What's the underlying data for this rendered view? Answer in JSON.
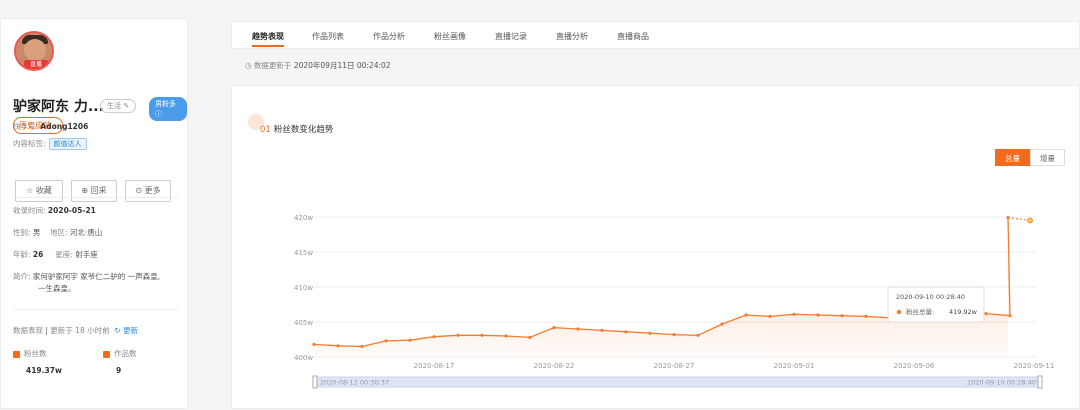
{
  "sidebar": {
    "avatar_tag": "直播",
    "name": "驴家阿东 力...",
    "gender_tag": "生活 ✎",
    "fans_tag": "男粉多 ⓘ",
    "history_label": "历史成就 ›",
    "kuaishou_label": "快手号:",
    "kuaishou_id": "Adong1206",
    "content_tag_label": "内容标签:",
    "content_tag": "颜值达人",
    "btn_collect": "☆ 收藏",
    "btn_back": "回采",
    "btn_more": "更多",
    "collect_time_label": "收录时间:",
    "collect_time": "2020-05-21",
    "gender_label": "性别:",
    "gender": "男",
    "region_label": "地区:",
    "region": "河北·唐山",
    "age_label": "年龄:",
    "age": "26",
    "zodiac_label": "星座:",
    "zodiac": "射手座",
    "intro_label": "简介:",
    "intro_line1": "家何驴家阿宇 家爷仁二驴的 一声森皇,",
    "intro_line2": "一生森皇。",
    "data_label": "数据表现",
    "data_update": "更新于 18 小时前",
    "refresh": "更新",
    "fans_label": "粉丝数",
    "fans_value": "419.37w",
    "works_label": "作品数",
    "works_value": "9"
  },
  "tabs": [
    "趋势表现",
    "作品列表",
    "作品分析",
    "粉丝画像",
    "直播记录",
    "直播分析",
    "直播商品"
  ],
  "update_text": "数据更新于",
  "update_time": "2020年09月11日 00:24:02",
  "section": {
    "num": "01",
    "title": "粉丝数变化趋势"
  },
  "toggles": {
    "total": "总量",
    "increment": "增量"
  },
  "tooltip": {
    "time": "2020-09-10 00:28:40",
    "label": "粉丝总量:",
    "value": "419.92w"
  },
  "range": {
    "start": "2020-08-12 00:30:37",
    "end": "2020-09-10 00:28:40"
  },
  "colors": {
    "accent": "#f26a1b",
    "line": "#f57c2e"
  },
  "chart_data": {
    "type": "line",
    "title": "",
    "xlabel": "",
    "ylabel": "",
    "ylim": [
      400,
      420
    ],
    "y_ticks": [
      "400w",
      "405w",
      "410w",
      "415w",
      "420w"
    ],
    "x_ticks": [
      "2020-08-17",
      "2020-08-22",
      "2020-08-27",
      "2020-09-01",
      "2020-09-06",
      "2020-09-11"
    ],
    "x": [
      "2020-08-12",
      "2020-08-13",
      "2020-08-14",
      "2020-08-15",
      "2020-08-16",
      "2020-08-17",
      "2020-08-18",
      "2020-08-19",
      "2020-08-20",
      "2020-08-21",
      "2020-08-22",
      "2020-08-23",
      "2020-08-24",
      "2020-08-25",
      "2020-08-26",
      "2020-08-27",
      "2020-08-28",
      "2020-08-29",
      "2020-08-30",
      "2020-08-31",
      "2020-09-01",
      "2020-09-02",
      "2020-09-03",
      "2020-09-04",
      "2020-09-05",
      "2020-09-06",
      "2020-09-07",
      "2020-09-08",
      "2020-09-09",
      "2020-09-10"
    ],
    "values": [
      401.8,
      401.6,
      401.5,
      402.3,
      402.4,
      402.9,
      403.1,
      403.1,
      403.0,
      402.8,
      404.2,
      404.0,
      403.8,
      403.6,
      403.4,
      403.2,
      403.1,
      404.7,
      406.0,
      405.8,
      406.1,
      406.0,
      405.9,
      405.8,
      405.6,
      406.5,
      406.3,
      406.3,
      406.2,
      405.9
    ],
    "final": {
      "x": "2020-09-10",
      "value": 419.92
    },
    "projection": {
      "x": "2020-09-11",
      "value": 419.5
    },
    "grid": true,
    "legend": "none"
  }
}
